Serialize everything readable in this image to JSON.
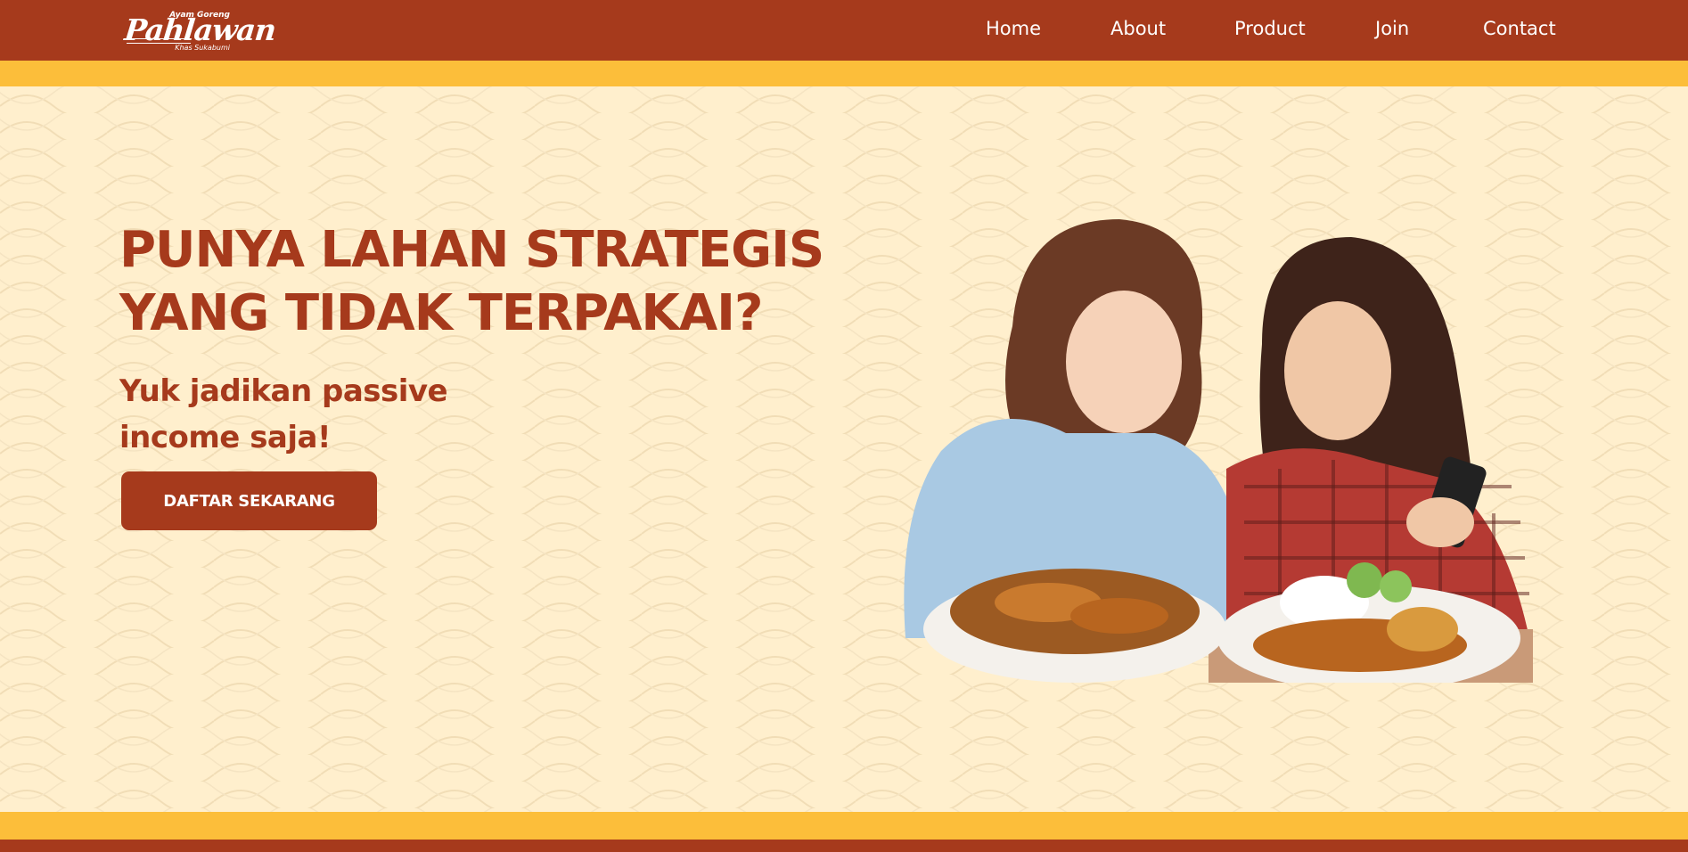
{
  "brand": {
    "name": "Pahlawan",
    "top_tag": "Ayam Goreng",
    "bottom_tag": "Khas Sukabumi"
  },
  "nav": {
    "items": [
      {
        "label": "Home"
      },
      {
        "label": "About"
      },
      {
        "label": "Product"
      },
      {
        "label": "Join"
      },
      {
        "label": "Contact"
      }
    ]
  },
  "hero": {
    "headline_line1": "PUNYA LAHAN STRATEGIS",
    "headline_line2": "YANG TIDAK TERPAKAI?",
    "sub_line1": "Yuk jadikan passive",
    "sub_line2": "income saja!",
    "cta_label": "DAFTAR SEKARANG",
    "image_alt": "two-women-eating-fried-chicken-photo"
  },
  "colors": {
    "primary": "#A63A1C",
    "accent_yellow": "#FCBE3A",
    "background_cream": "#FFEFCD"
  }
}
